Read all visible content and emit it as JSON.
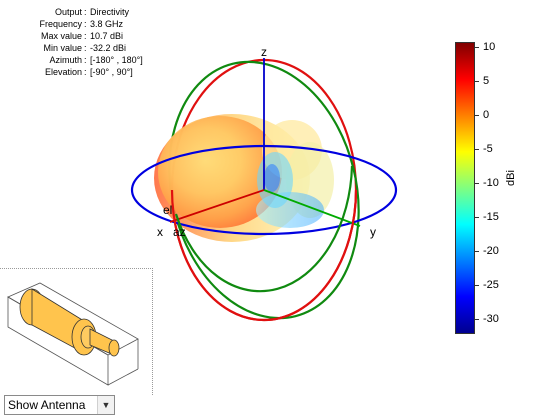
{
  "info": {
    "rows": [
      {
        "key": "Output",
        "value": "Directivity"
      },
      {
        "key": "Frequency",
        "value": "3.8 GHz"
      },
      {
        "key": "Max value",
        "value": "10.7 dBi"
      },
      {
        "key": "Min value",
        "value": "-32.2 dBi"
      },
      {
        "key": "Azimuth",
        "value": "[-180° , 180°]"
      },
      {
        "key": "Elevation",
        "value": "[-90° , 90°]"
      }
    ]
  },
  "axes": {
    "x_label": "x",
    "y_label": "y",
    "z_label": "z",
    "az_label": "az",
    "el_label": "el"
  },
  "colorbar": {
    "unit": "dBi",
    "min": -32.2,
    "max": 10.7,
    "ticks": [
      "10",
      "5",
      "0",
      "-5",
      "-10",
      "-15",
      "-20",
      "-25",
      "-30"
    ]
  },
  "preview": {
    "dropdown_value": "Show Antenna"
  },
  "colors": {
    "azimuth_ring": "#0000e0",
    "elevation_ring_xz": "#e01010",
    "elevation_ring_yz": "#108a10",
    "z_axis": "#0000cc",
    "x_axis": "#cc0000",
    "y_axis": "#00aa00",
    "antenna": "#ffc44d"
  }
}
